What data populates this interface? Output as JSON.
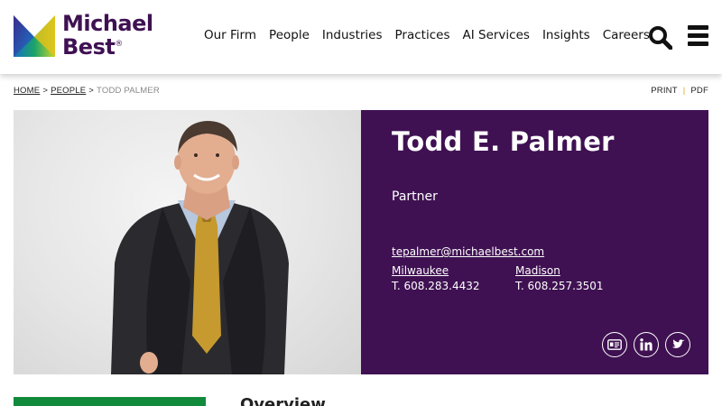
{
  "brand": {
    "line1": "Michael",
    "line2": "Best",
    "reg": "®",
    "color": "#3f1152"
  },
  "nav": {
    "items": [
      "Our Firm",
      "People",
      "Industries",
      "Practices",
      "AI Services",
      "Insights",
      "Careers"
    ],
    "search_icon": "search-icon",
    "menu_icon": "hamburger-menu-icon"
  },
  "breadcrumb": {
    "home": "HOME",
    "people": "PEOPLE",
    "separator": ">",
    "current": "TODD PALMER"
  },
  "tools": {
    "print": "PRINT",
    "pdf": "PDF",
    "divider": "|"
  },
  "profile": {
    "name": "Todd E. Palmer",
    "title": "Partner",
    "email": "tepalmer@michaelbest.com",
    "offices": [
      {
        "city": "Milwaukee",
        "phone": "T.  608.283.4432"
      },
      {
        "city": "Madison",
        "phone": "T.  608.257.3501"
      }
    ],
    "social_icons": [
      "vcard-icon",
      "linkedin-icon",
      "twitter-icon"
    ],
    "bg_color": "#3f1152"
  },
  "content": {
    "section_heading": "Overview",
    "accent_color": "#128a3c"
  }
}
